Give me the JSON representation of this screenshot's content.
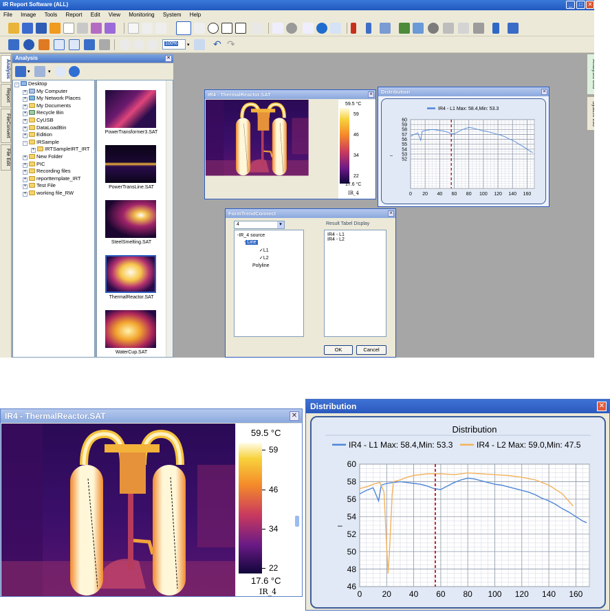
{
  "app": {
    "title": "IR Report Software (ALL)",
    "menu": [
      "File",
      "Image",
      "Tools",
      "Report",
      "Edit",
      "View",
      "Monitoring",
      "System",
      "Help"
    ],
    "zoom": "100%"
  },
  "left_tabs": [
    "Analysis",
    "Report",
    "FileConvert",
    "File Edit"
  ],
  "right_tabs": [
    "Analysis Info",
    "System Info"
  ],
  "analysis_panel": {
    "title": "Analysis"
  },
  "file_tree": [
    {
      "label": "Desktop",
      "level": 0
    },
    {
      "label": "My Computer",
      "level": 1
    },
    {
      "label": "My Network Places",
      "level": 1
    },
    {
      "label": "My Documents",
      "level": 1
    },
    {
      "label": "Recycle Bin",
      "level": 1
    },
    {
      "label": "CyUSB",
      "level": 1
    },
    {
      "label": "DataLoadBin",
      "level": 1
    },
    {
      "label": "Edition",
      "level": 1
    },
    {
      "label": "IRSample",
      "level": 1
    },
    {
      "label": "IRTSampleIRT_IRT",
      "level": 2
    },
    {
      "label": "New Folder",
      "level": 1
    },
    {
      "label": "PIC",
      "level": 1
    },
    {
      "label": "Recording files",
      "level": 1
    },
    {
      "label": "reporttemplate_IRT",
      "level": 1
    },
    {
      "label": "Test File",
      "level": 1
    },
    {
      "label": "working file_RW",
      "level": 1
    }
  ],
  "thumbnails": [
    "PowerTransformer3.SAT",
    "PowerTransLine.SAT",
    "SteelSmelting.SAT",
    "ThermalReactor.SAT",
    "WaterCup.SAT"
  ],
  "thermal_window": {
    "title": "IR4 - ThermalReactor.SAT",
    "max_label": "59.5 °C",
    "min_label": "17.6 °C",
    "scale_ticks": [
      "59",
      "46",
      "34",
      "22"
    ],
    "image_name": "IR_4"
  },
  "distribution_window": {
    "title": "Distribution",
    "chart_title": "Distribution",
    "legend_l1": "IR4 - L1 Max: 58.4,Min: 53.3",
    "legend_l2": "IR4 - L2 Max: 59.0,Min: 47.5",
    "ylabel": "–"
  },
  "form_trend": {
    "title": "FormTrendConnect",
    "combo_value": "4",
    "result_label": "Result Tabel Display",
    "tree": [
      "IR_4 source",
      "Line",
      "L1",
      "L2",
      "Polyline"
    ],
    "results": [
      "IR4 - L1",
      "IR4 - L2"
    ],
    "ok_label": "OK",
    "cancel_label": "Cancel"
  },
  "colors": {
    "l1": "#4e86d8",
    "l2": "#f3b25c",
    "cursor": "#c41e1e",
    "frame": "#2a5bbf"
  },
  "chart_data": {
    "type": "line",
    "title": "Distribution",
    "xlim": [
      0,
      170
    ],
    "ylim": [
      46,
      60
    ],
    "xticks": [
      0,
      20,
      40,
      60,
      80,
      100,
      120,
      140,
      160
    ],
    "yticks": [
      46,
      48,
      50,
      52,
      54,
      56,
      58,
      60
    ],
    "grid": true,
    "legend": "top",
    "cursor_x": 56,
    "series": [
      {
        "name": "IR4 - L1 Max: 58.4,Min: 53.3",
        "x": [
          0,
          5,
          10,
          14,
          16,
          20,
          25,
          30,
          35,
          40,
          45,
          50,
          55,
          60,
          65,
          70,
          75,
          80,
          85,
          90,
          95,
          100,
          105,
          110,
          115,
          120,
          125,
          130,
          135,
          140,
          145,
          150,
          155,
          160,
          165,
          168
        ],
        "y": [
          56.6,
          57.0,
          57.3,
          55.8,
          57.6,
          57.8,
          57.9,
          58.0,
          57.9,
          57.8,
          57.7,
          57.5,
          57.2,
          57.1,
          57.5,
          57.9,
          58.2,
          58.4,
          58.3,
          58.1,
          57.9,
          57.7,
          57.6,
          57.4,
          57.2,
          57.0,
          56.8,
          56.5,
          56.1,
          55.8,
          55.4,
          54.9,
          54.5,
          54.0,
          53.5,
          53.3
        ]
      },
      {
        "name": "IR4 - L2 Max: 59.0,Min: 47.5",
        "x": [
          0,
          5,
          10,
          15,
          18,
          20,
          21,
          22,
          24,
          25,
          30,
          35,
          40,
          50,
          60,
          70,
          80,
          90,
          100,
          110,
          120,
          130,
          140,
          150,
          158
        ],
        "y": [
          57.2,
          57.4,
          57.7,
          57.9,
          56.8,
          50.5,
          47.5,
          49.8,
          56.5,
          58.0,
          58.2,
          58.5,
          58.7,
          58.9,
          58.9,
          58.8,
          59.0,
          58.9,
          58.8,
          58.7,
          58.5,
          58.2,
          57.6,
          56.6,
          55.2
        ]
      }
    ]
  }
}
